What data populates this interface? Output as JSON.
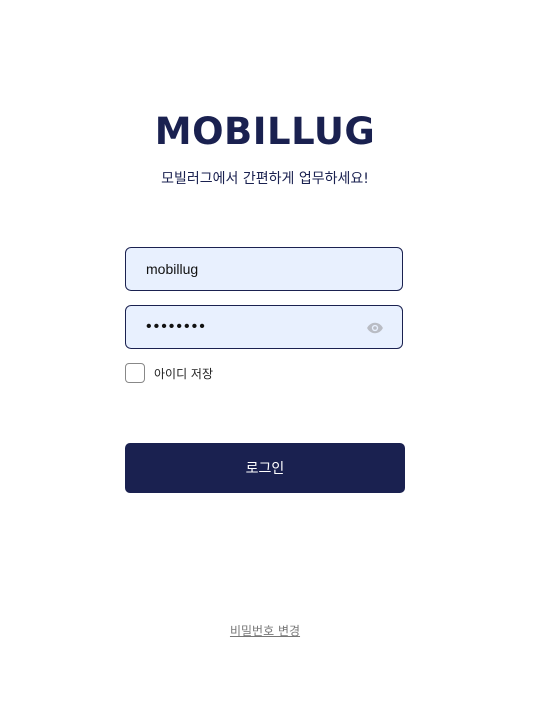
{
  "brand": {
    "logo_text": "MOBILLUG",
    "tagline": "모빌러그에서 간편하게 업무하세요!"
  },
  "form": {
    "username_value": "mobillug",
    "password_value": "password",
    "remember_label": "아이디 저장",
    "login_label": "로그인",
    "change_password_label": "비밀번호 변경"
  },
  "colors": {
    "brand_navy": "#1a2150",
    "input_fill": "#e8f0fe",
    "muted_text": "#777777"
  },
  "icons": {
    "password_toggle": "eye-icon"
  }
}
